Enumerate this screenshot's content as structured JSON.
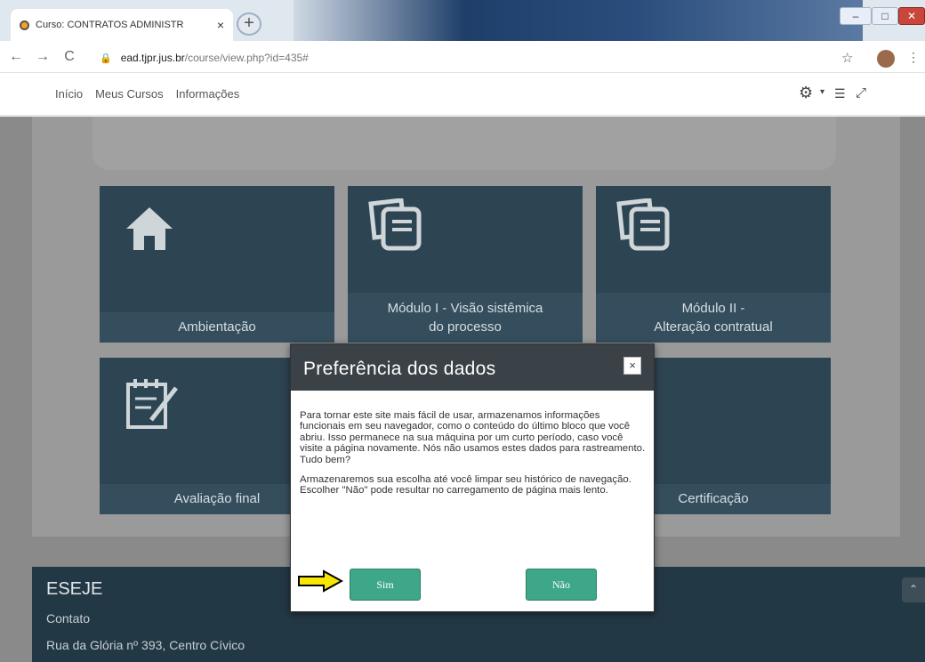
{
  "browser": {
    "tab_title": "Curso: CONTRATOS ADMINISTR",
    "tab_close": "×",
    "new_tab": "+",
    "url_host": "ead.tjpr.jus.br",
    "url_path": "/course/view.php?id=435#",
    "back": "←",
    "forward": "→",
    "reload": "C",
    "star": "☆",
    "menu": "⋮"
  },
  "nav": {
    "items": [
      "Início",
      "Meus Cursos",
      "Informações"
    ],
    "gear": "⚙",
    "caret": "▾",
    "drawer": "☰",
    "expand": "⤢"
  },
  "tiles": {
    "ambientacao": "Ambientação",
    "modulo1_line1": "Módulo I - Visão sistêmica",
    "modulo1_line2": "do processo",
    "modulo2_line1": "Módulo II -",
    "modulo2_line2": "Alteração contratual",
    "avaliacao": "Avaliação final",
    "certificacao": "Certificação"
  },
  "footer": {
    "brand": "ESEJE",
    "contato": "Contato",
    "address": "Rua da Glória nº 393, Centro Cívico",
    "scroll_top": "⌃"
  },
  "modal": {
    "title": "Preferência dos dados",
    "close": "×",
    "paragraph1": "Para tornar este site mais fácil de usar, armazenamos informações funcionais em seu navegador, como o conteúdo do último bloco que você abriu. Isso permanece na sua máquina por um curto período, caso você visite a página novamente. Nós não usamos estes dados para rastreamento. Tudo bem?",
    "paragraph2": "Armazenaremos sua escolha até você limpar seu histórico de navegação. Escolher \"Não\" pode resultar no carregamento de página mais lento.",
    "yes": "Sim",
    "no": "Não"
  },
  "colors": {
    "tile_bg": "#2d4452",
    "button_green": "#3ea78a",
    "modal_header": "#3a4247",
    "arrow_yellow": "#f6e600"
  }
}
